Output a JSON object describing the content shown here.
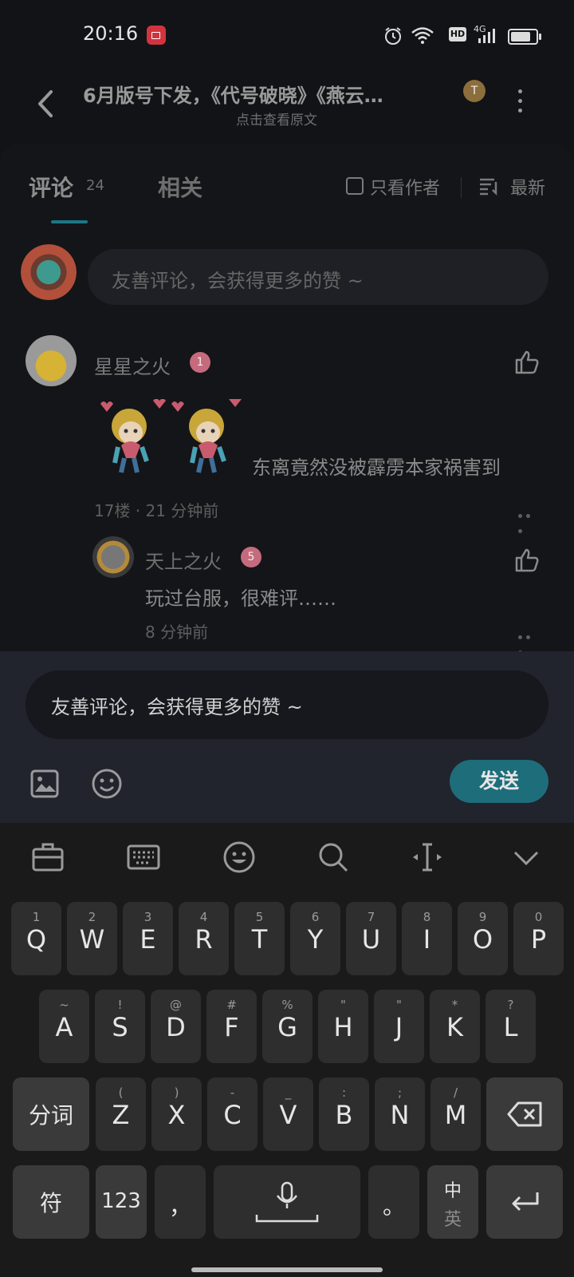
{
  "status_bar": {
    "time": "20:16",
    "hd": "HD",
    "network": "4G"
  },
  "header": {
    "title": "6月版号下发，《代号破晓》《燕云…",
    "subtitle": "点击查看原文",
    "author_initial": "T"
  },
  "tabs": {
    "comments": "评论",
    "comments_count": "24",
    "related": "相关",
    "author_only": "只看作者",
    "sort": "最新"
  },
  "top_input": {
    "placeholder": "友善评论，会获得更多的赞 ~"
  },
  "comments": [
    {
      "name": "星星之火",
      "level": "1",
      "text": "东离竟然没被霹雳本家祸害到",
      "meta": "17楼 · 21 分钟前",
      "replies": [
        {
          "name": "天上之火",
          "level": "5",
          "text": "玩过台服，很难评……",
          "meta": "8 分钟前"
        }
      ]
    }
  ],
  "compose": {
    "placeholder": "友善评论，会获得更多的赞 ~",
    "send": "发送"
  },
  "keyboard": {
    "row1": [
      {
        "hint": "1",
        "key": "Q"
      },
      {
        "hint": "2",
        "key": "W"
      },
      {
        "hint": "3",
        "key": "E"
      },
      {
        "hint": "4",
        "key": "R"
      },
      {
        "hint": "5",
        "key": "T"
      },
      {
        "hint": "6",
        "key": "Y"
      },
      {
        "hint": "7",
        "key": "U"
      },
      {
        "hint": "8",
        "key": "I"
      },
      {
        "hint": "9",
        "key": "O"
      },
      {
        "hint": "0",
        "key": "P"
      }
    ],
    "row2": [
      {
        "hint": "~",
        "key": "A"
      },
      {
        "hint": "!",
        "key": "S"
      },
      {
        "hint": "@",
        "key": "D"
      },
      {
        "hint": "#",
        "key": "F"
      },
      {
        "hint": "%",
        "key": "G"
      },
      {
        "hint": "\"",
        "key": "H"
      },
      {
        "hint": "\"",
        "key": "J"
      },
      {
        "hint": "*",
        "key": "K"
      },
      {
        "hint": "?",
        "key": "L"
      }
    ],
    "row3": [
      {
        "hint": "(",
        "key": "Z"
      },
      {
        "hint": ")",
        "key": "X"
      },
      {
        "hint": "-",
        "key": "C"
      },
      {
        "hint": "_",
        "key": "V"
      },
      {
        "hint": ":",
        "key": "B"
      },
      {
        "hint": ";",
        "key": "N"
      },
      {
        "hint": "/",
        "key": "M"
      }
    ],
    "segment_key": "分词",
    "symbol_key": "符",
    "num_key": "123",
    "comma_key": "，",
    "period_key": "。",
    "lang_top": "中",
    "lang_bottom": "英"
  }
}
